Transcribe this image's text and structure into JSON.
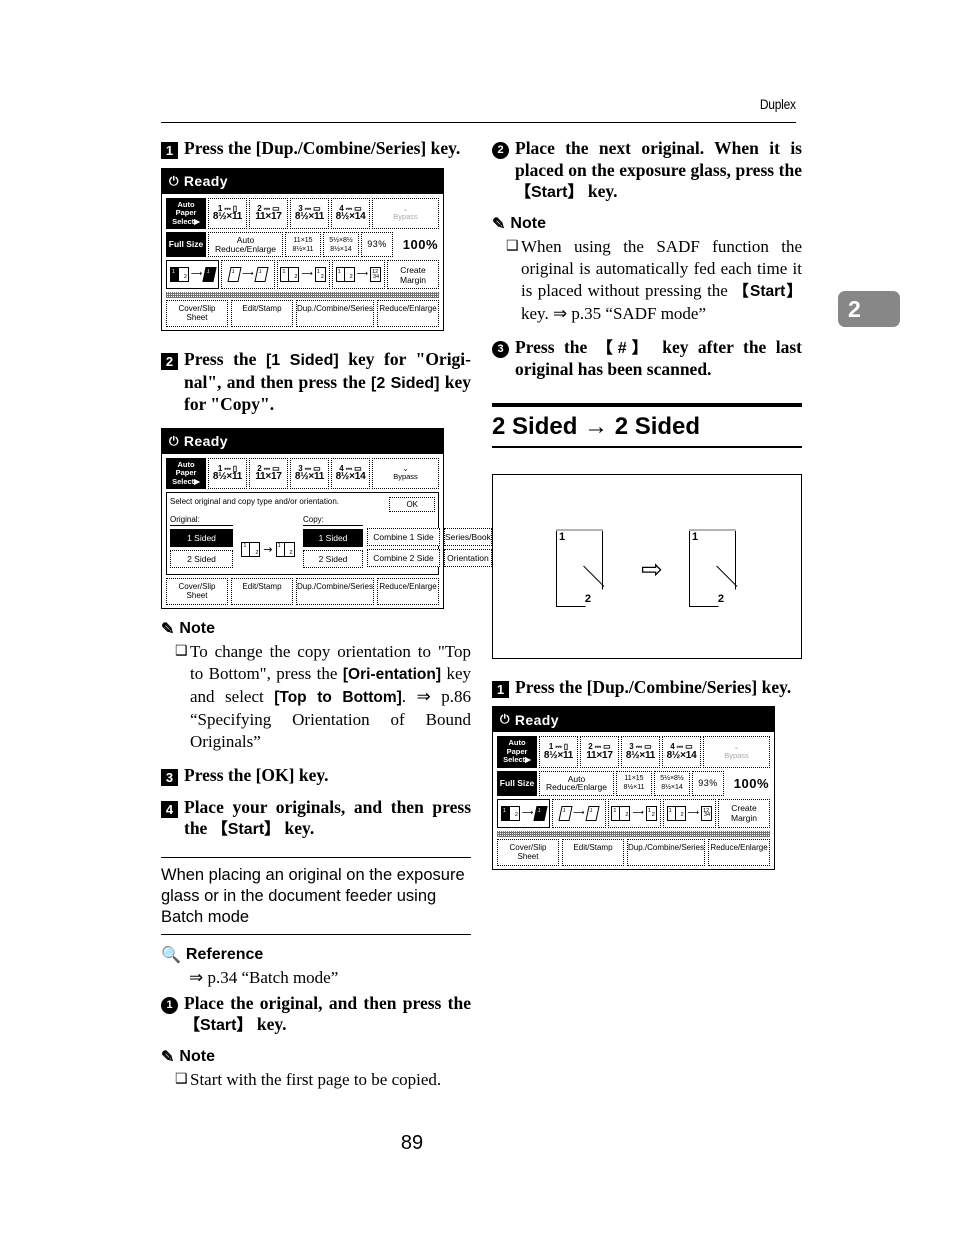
{
  "header": {
    "running_head": "Duplex"
  },
  "chapter_tab": {
    "number": "2"
  },
  "page_number": "89",
  "left_column": {
    "step1": {
      "num": "1",
      "text": "Press the [Dup./Combine/Series] key."
    },
    "step2": {
      "num": "2",
      "text_a": "Press the ",
      "key_a": "[1 Sided]",
      "text_b": " key for \"Origi-nal\", and then press the ",
      "key_b": "[2 Sided]",
      "text_c": " key for \"Copy\"."
    },
    "note1": {
      "heading": "Note",
      "icon": "pencil-icon",
      "bullet": "❑",
      "body_a": "To change the copy orientation to \"Top to Bottom\", press the ",
      "key_a": "[Ori-entation]",
      "body_b": " key and select ",
      "key_b": "[Top to Bottom]",
      "body_c": ". ⇒ p.86 “Specifying Orientation of Bound Originals”"
    },
    "step3": {
      "num": "3",
      "text": "Press the [OK] key."
    },
    "step4": {
      "num": "4",
      "text_a": "Place  your  originals,  and  then press the ",
      "key_a": "【Start】",
      "text_b": " key."
    },
    "subsection": "When placing an original on the exposure glass or in the document feeder using Batch mode",
    "reference": {
      "heading": "Reference",
      "icon": "magnifier-icon",
      "line": "⇒ p.34 “Batch mode”"
    },
    "bstep1": {
      "num": "1",
      "text_a": "Place  the  original,  and  then press the ",
      "key_a": "【Start】",
      "text_b": " key."
    },
    "note2": {
      "heading": "Note",
      "icon": "pencil-icon",
      "bullet": "❑",
      "body": "Start with the first page to be copied."
    }
  },
  "right_column": {
    "step2": {
      "num": "2",
      "text_a": "Place the next original. When it is placed on the exposure glass, press the ",
      "key_a": "【Start】",
      "text_b": " key."
    },
    "note": {
      "heading": "Note",
      "icon": "pencil-icon",
      "bullet": "❑",
      "body_a": "When using the SADF function the original is automatically fed each time it is placed without pressing the ",
      "key_a": "【Start】",
      "body_b": " key. ⇒ p.35 “SADF mode”"
    },
    "step3": {
      "num": "3",
      "text_a": "Press the ",
      "key_a": "【#】",
      "text_b": " key after the last original has been scanned."
    },
    "major_heading": "2 Sided → 2 Sided",
    "illustration": {
      "name": "two-sided-to-two-sided-diagram",
      "left_sheet": {
        "front": "1",
        "back": "2"
      },
      "arrow": "⇨",
      "right_sheet": {
        "front": "1",
        "back": "2"
      }
    },
    "step1": {
      "num": "1",
      "text": "Press the [Dup./Combine/Series] key."
    }
  },
  "lcd_main": {
    "title": "Ready",
    "power_icon": "power-icon",
    "paper_row": {
      "tray_select": {
        "l1": "Auto Paper",
        "l2": "Select▶",
        "selected": true
      },
      "trays": [
        {
          "num": "1",
          "size": "8½×11",
          "orient": "portrait"
        },
        {
          "num": "2",
          "size": "11×17",
          "orient": "landscape"
        },
        {
          "num": "3",
          "size": "8½×11",
          "orient": "landscape"
        },
        {
          "num": "4",
          "size": "8½×14",
          "orient": "landscape"
        }
      ],
      "bypass": "Bypass"
    },
    "zoom_row": {
      "full_size": "Full Size",
      "auto_reduce": "Auto Reduce/Enlarge",
      "ratio1": {
        "top": "11×15",
        "bottom": "8½×11"
      },
      "ratio2": {
        "top": "5½×8½",
        "bottom": "8½×14"
      },
      "preset": "93%",
      "current": "100%"
    },
    "duplex_row": {
      "keys": [
        {
          "label": "1-sided-to-2-sided",
          "selected": true
        },
        {
          "label": "2-sided-to-2-sided",
          "selected": false
        },
        {
          "label": "2-pages-to-1-side",
          "selected": false
        },
        {
          "label": "4-pages-to-1-side",
          "selected": false
        }
      ],
      "create_margin": {
        "l1": "Create",
        "l2": "Margin"
      }
    },
    "tabs": [
      "Cover/Slip Sheet",
      "Edit/Stamp",
      "Dup./Combine/Series",
      "Reduce/Enlarge"
    ]
  },
  "lcd_duplex": {
    "title": "Ready",
    "power_icon": "power-icon",
    "paper_row": {
      "tray_select": {
        "l1": "Auto Paper",
        "l2": "Select▶",
        "selected": true
      },
      "trays": [
        {
          "num": "1",
          "size": "8½×11",
          "orient": "portrait"
        },
        {
          "num": "2",
          "size": "11×17",
          "orient": "landscape"
        },
        {
          "num": "3",
          "size": "8½×11",
          "orient": "landscape"
        },
        {
          "num": "4",
          "size": "8½×14",
          "orient": "landscape"
        }
      ],
      "bypass": "Bypass"
    },
    "message": "Select original and copy type and/or orientation.",
    "ok_button": "OK",
    "original_label": "Original:",
    "copy_label": "Copy:",
    "original_buttons": [
      {
        "label": "1 Sided",
        "selected": true
      },
      {
        "label": "2 Sided",
        "selected": false
      }
    ],
    "copy_buttons": [
      {
        "label": "1 Sided",
        "selected": true
      },
      {
        "label": "2 Sided",
        "selected": false
      }
    ],
    "combine_buttons": [
      {
        "label": "Combine 1 Side",
        "selected": false
      },
      {
        "label": "Combine 2 Side",
        "selected": false
      }
    ],
    "side_buttons": [
      {
        "label": "Series/Book",
        "selected": false
      },
      {
        "label": "Orientation",
        "selected": false
      }
    ],
    "tabs": [
      "Cover/Slip Sheet",
      "Edit/Stamp",
      "Dup./Combine/Series",
      "Reduce/Enlarge"
    ]
  }
}
